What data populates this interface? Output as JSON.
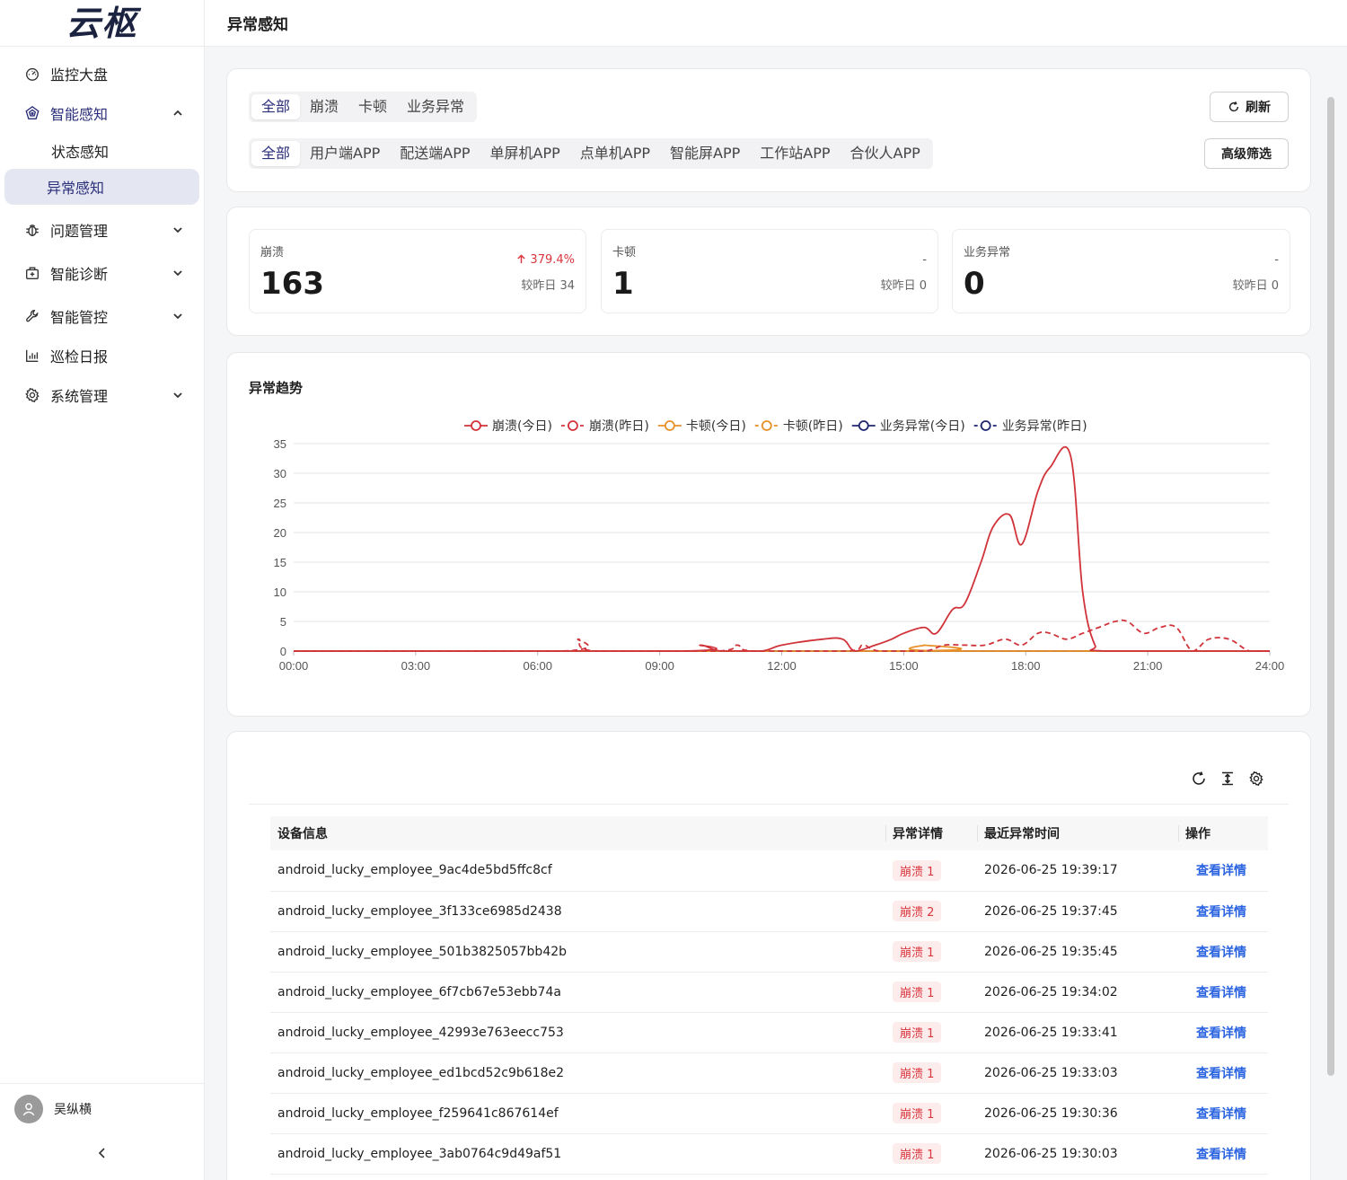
{
  "brand": {
    "logo_text": "云枢"
  },
  "sidebar": {
    "items": [
      {
        "label": "监控大盘",
        "icon": "dashboard-icon"
      },
      {
        "label": "智能感知",
        "icon": "radar-icon",
        "expanded": true,
        "children": [
          {
            "label": "状态感知"
          },
          {
            "label": "异常感知",
            "selected": true
          }
        ]
      },
      {
        "label": "问题管理",
        "icon": "bug-icon"
      },
      {
        "label": "智能诊断",
        "icon": "medkit-icon"
      },
      {
        "label": "智能管控",
        "icon": "wrench-icon"
      },
      {
        "label": "巡检日报",
        "icon": "bar-chart-icon"
      },
      {
        "label": "系统管理",
        "icon": "gear-icon"
      }
    ],
    "user_name": "吴纵横",
    "collapse_label": "<"
  },
  "header": {
    "title": "异常感知"
  },
  "filters": {
    "types": [
      "全部",
      "崩溃",
      "卡顿",
      "业务异常"
    ],
    "apps": [
      "全部",
      "用户端APP",
      "配送端APP",
      "单屏机APP",
      "点单机APP",
      "智能屏APP",
      "工作站APP",
      "合伙人APP"
    ],
    "refresh_label": "刷新",
    "advanced_label": "高级筛选"
  },
  "stats": [
    {
      "label": "崩溃",
      "value": "163",
      "change": "379.4%",
      "trend": "up",
      "prev": "较昨日 34"
    },
    {
      "label": "卡顿",
      "value": "1",
      "change": "-",
      "trend": "none",
      "prev": "较昨日 0"
    },
    {
      "label": "业务异常",
      "value": "0",
      "change": "-",
      "trend": "none",
      "prev": "较昨日 0"
    }
  ],
  "chart_title": "异常趋势",
  "chart_data": {
    "type": "line",
    "title": "异常趋势",
    "x_labels": [
      "00:00",
      "03:00",
      "06:00",
      "09:00",
      "12:00",
      "15:00",
      "18:00",
      "21:00",
      "24:00"
    ],
    "xlim": [
      0,
      24
    ],
    "ylim": [
      0,
      35
    ],
    "y_ticks": [
      0,
      5,
      10,
      15,
      20,
      25,
      30,
      35
    ],
    "grid": true,
    "legend_position": "top",
    "series": [
      {
        "name": "崩溃(今日)",
        "color": "#d0343a",
        "dashed": false,
        "x": [
          0,
          9.5,
          10,
          10.5,
          11.5,
          12,
          13,
          13.5,
          13.8,
          14.3,
          14.7,
          15,
          15.5,
          15.8,
          16.2,
          16.5,
          16.9,
          17.2,
          17.6,
          17.9,
          18.3,
          18.6,
          19.1,
          19.4,
          19.7,
          20,
          24
        ],
        "y": [
          0,
          0,
          1,
          0,
          0,
          1,
          2,
          2,
          0,
          1,
          2,
          3,
          4,
          3,
          7,
          8,
          15,
          21,
          23,
          18,
          27,
          31,
          33,
          10,
          1,
          0,
          0
        ]
      },
      {
        "name": "崩溃(昨日)",
        "color": "#d0343a",
        "dashed": true,
        "x": [
          0,
          6.6,
          7,
          7.4,
          10.4,
          10.9,
          11.3,
          13.6,
          14,
          14.4,
          15.5,
          16,
          16.5,
          17,
          17.5,
          17.9,
          18.3,
          18.6,
          19,
          19.4,
          19.8,
          20.2,
          20.5,
          20.9,
          21.3,
          21.7,
          22.1,
          22.5,
          23,
          23.5,
          24
        ],
        "y": [
          0,
          0,
          2,
          0,
          0,
          1,
          0,
          0,
          1,
          0,
          0,
          1,
          1,
          1,
          2,
          1,
          3,
          3,
          2,
          3,
          4,
          5,
          5,
          3,
          4,
          4,
          0,
          2,
          2,
          0,
          0
        ]
      },
      {
        "name": "卡顿(今日)",
        "color": "#e8902a",
        "dashed": false,
        "x": [
          0,
          15.1,
          15.5,
          15.9,
          24
        ],
        "y": [
          0,
          0,
          1,
          0,
          0
        ]
      },
      {
        "name": "卡顿(昨日)",
        "color": "#e8902a",
        "dashed": true,
        "x": [
          0,
          24
        ],
        "y": [
          0,
          0
        ]
      },
      {
        "name": "业务异常(今日)",
        "color": "#1f2670",
        "dashed": false,
        "x": [
          0,
          24
        ],
        "y": [
          0,
          0
        ]
      },
      {
        "name": "业务异常(昨日)",
        "color": "#1f2670",
        "dashed": true,
        "x": [
          0,
          24
        ],
        "y": [
          0,
          0
        ]
      }
    ]
  },
  "table": {
    "columns": [
      "设备信息",
      "异常详情",
      "最近异常时间",
      "操作"
    ],
    "rows": [
      {
        "device": "android_lucky_employee_9ac4de5bd5ffc8cf",
        "detail": "崩溃 1",
        "time": "2026-06-25 19:39:17",
        "action": "查看详情"
      },
      {
        "device": "android_lucky_employee_3f133ce6985d2438",
        "detail": "崩溃 2",
        "time": "2026-06-25 19:37:45",
        "action": "查看详情"
      },
      {
        "device": "android_lucky_employee_501b3825057bb42b",
        "detail": "崩溃 1",
        "time": "2026-06-25 19:35:45",
        "action": "查看详情"
      },
      {
        "device": "android_lucky_employee_6f7cb67e53ebb74a",
        "detail": "崩溃 1",
        "time": "2026-06-25 19:34:02",
        "action": "查看详情"
      },
      {
        "device": "android_lucky_employee_42993e763eecc753",
        "detail": "崩溃 1",
        "time": "2026-06-25 19:33:41",
        "action": "查看详情"
      },
      {
        "device": "android_lucky_employee_ed1bcd52c9b618e2",
        "detail": "崩溃 1",
        "time": "2026-06-25 19:33:03",
        "action": "查看详情"
      },
      {
        "device": "android_lucky_employee_f259641c867614ef",
        "detail": "崩溃 1",
        "time": "2026-06-25 19:30:36",
        "action": "查看详情"
      },
      {
        "device": "android_lucky_employee_3ab0764c9d49af51",
        "detail": "崩溃 1",
        "time": "2026-06-25 19:30:03",
        "action": "查看详情"
      }
    ]
  }
}
